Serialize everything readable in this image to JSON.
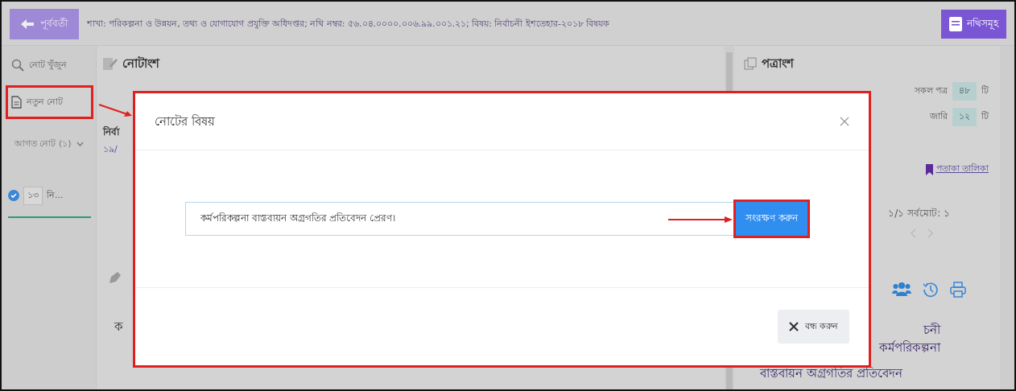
{
  "topbar": {
    "back_button": "পূর্ববর্তী",
    "breadcrumb": "শাখা: পরিকল্পনা ও উন্নয়ন, তথ্য ও যোগাযোগ প্রযুক্তি অধিদপ্তর; নথি নম্বর: ৫৬.০৪.০০০০.০০৬.৯৯.০০১.২১; বিষয়: নির্বাচনী ইশতেহার-২০১৮ বিষয়ক",
    "files_button": "নথিসমূহ"
  },
  "sidebar": {
    "search": "নোট খুঁজুন",
    "new_note": "নতুন নোট",
    "incoming": "আগত নোট (১)",
    "notes": [
      {
        "number": "১৩",
        "title": "নি...",
        "checked": true
      }
    ]
  },
  "notes_panel": {
    "title": "নোটাংশ",
    "tab_title": "নির্বা",
    "tab_date": "১৯/",
    "body_text": "ক"
  },
  "letters_panel": {
    "title": "পত্রাংশ",
    "counts": [
      {
        "label": "সকল পত্র",
        "count": "৪৮",
        "unit": "টি"
      },
      {
        "label": "জারি",
        "count": "১২",
        "unit": "টি"
      }
    ],
    "flag_link": "পতাকা তালিকা",
    "pager": "১/১ সর্বমোট: ১",
    "preview_lines": [
      "চনী",
      "কর্মপরিকল্পনা",
      "বাস্তবায়ন অগ্রগতির প্রতিবেদন"
    ]
  },
  "modal": {
    "title": "নোটের বিষয়",
    "input_value": "কর্মপরিকল্পনা বাস্তবায়ন অগ্রগতির প্রতিবেদন প্রেরণ।",
    "save_button": "সংরক্ষণ করুন",
    "close_button": "বন্ধ করুন"
  }
}
